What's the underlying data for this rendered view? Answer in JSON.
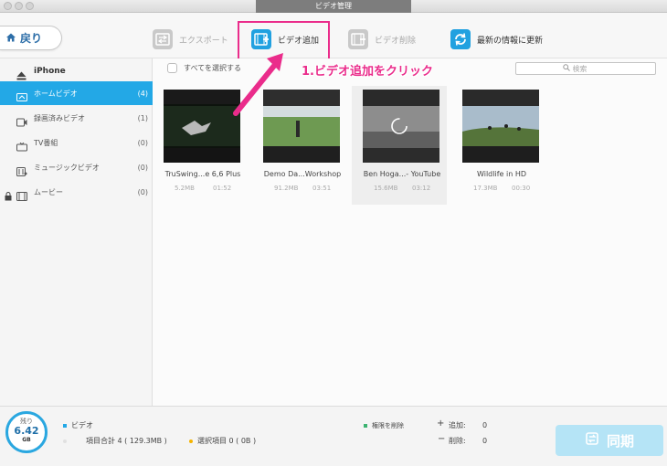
{
  "window": {
    "title": "ビデオ管理"
  },
  "toolbar": {
    "back_label": "戻り",
    "export_label": "エクスポート",
    "add_label": "ビデオ追加",
    "delete_label": "ビデオ削除",
    "refresh_label": "最新の情報に更新"
  },
  "sidebar": {
    "device": "iPhone",
    "items": [
      {
        "label": "ホームビデオ",
        "count": "(4)",
        "icon": "home-video-icon"
      },
      {
        "label": "録画済みビデオ",
        "count": "(1)",
        "icon": "recorded-video-icon"
      },
      {
        "label": "TV番組",
        "count": "(0)",
        "icon": "tv-icon"
      },
      {
        "label": "ミュージックビデオ",
        "count": "(0)",
        "icon": "music-video-icon"
      },
      {
        "label": "ムービー",
        "count": "(0)",
        "icon": "movie-icon"
      }
    ]
  },
  "content": {
    "select_all_label": "すべてを選択する",
    "search_placeholder": "検索",
    "videos": [
      {
        "name": "TruSwing...e 6,6 Plus",
        "size": "5.2MB",
        "duration": "01:52"
      },
      {
        "name": "Demo Da...Workshop",
        "size": "91.2MB",
        "duration": "03:51"
      },
      {
        "name": "Ben Hoga...- YouTube",
        "size": "15.6MB",
        "duration": "03:12"
      },
      {
        "name": "Wildlife in HD",
        "size": "17.3MB",
        "duration": "00:30"
      }
    ]
  },
  "annotation": {
    "label": "1.ビデオ追加をクリック"
  },
  "bottom": {
    "storage_label": "残り",
    "storage_value": "6.42",
    "storage_unit": "GB",
    "category_label": "ビデオ",
    "total_label": "項目合計 4 ( 129.3MB )",
    "selected_label": "選択項目 0 ( 0B )",
    "delete_legend": "権限を削除",
    "add_label": "追加:",
    "add_value": "0",
    "remove_label": "削除:",
    "remove_value": "0",
    "sync_label": "同期"
  },
  "colors": {
    "accent": "#23a8e6",
    "annotation": "#ea2c8b",
    "legend_video": "#23a8e6",
    "legend_delete": "#3cb371",
    "legend_selected": "#f5b400"
  }
}
